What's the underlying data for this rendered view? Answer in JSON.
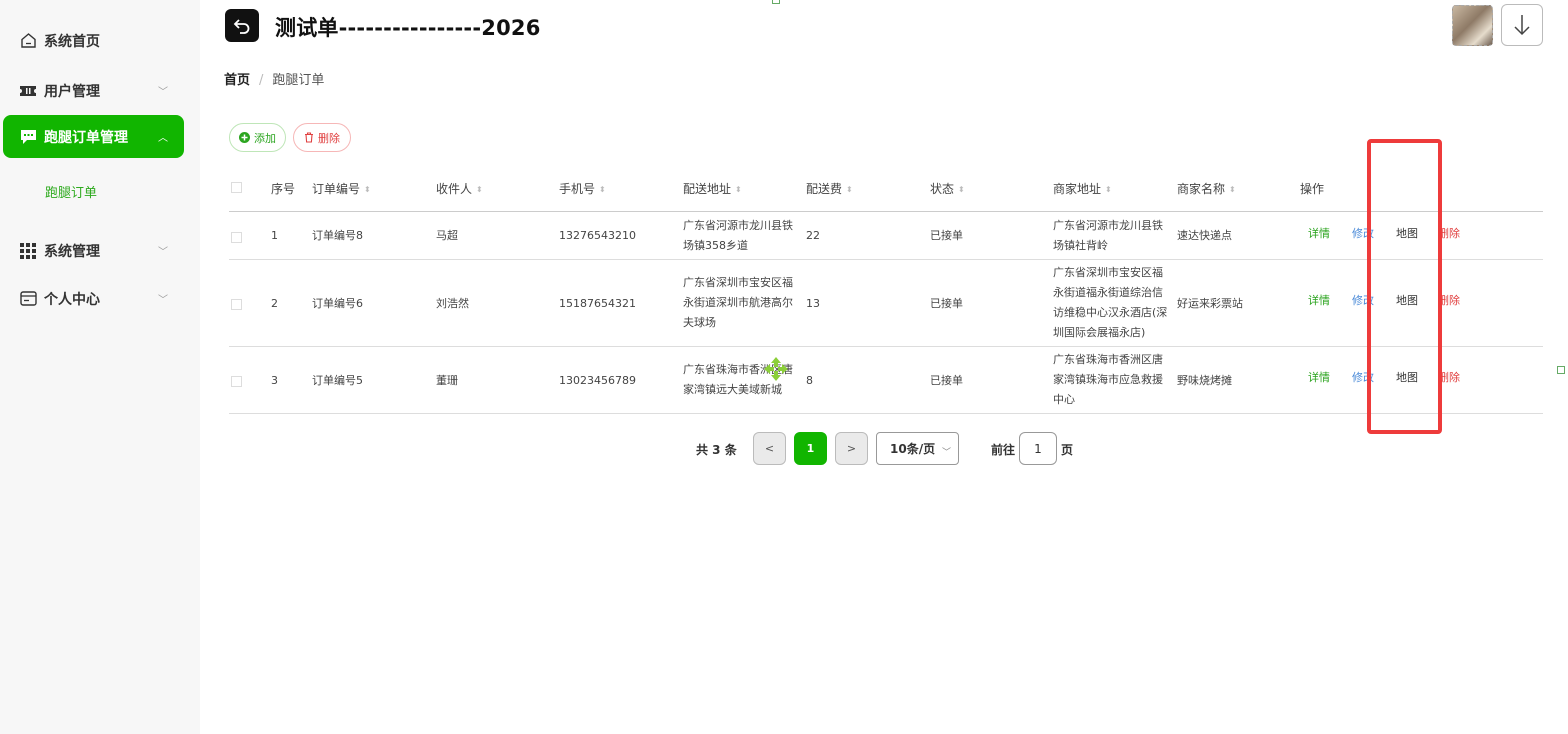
{
  "sidebar": {
    "items": [
      {
        "label": "系统首页"
      },
      {
        "label": "用户管理"
      },
      {
        "label": "跑腿订单管理"
      },
      {
        "label": "系统管理"
      },
      {
        "label": "个人中心"
      }
    ],
    "subitem": "跑腿订单"
  },
  "header": {
    "title": "测试单----------------2026"
  },
  "breadcrumb": {
    "home": "首页",
    "separator": "/",
    "current": "跑腿订单"
  },
  "toolbar": {
    "add_label": "添加",
    "delete_label": "删除"
  },
  "table": {
    "columns": [
      "序号",
      "订单编号",
      "收件人",
      "手机号",
      "配送地址",
      "配送费",
      "状态",
      "商家地址",
      "商家名称",
      "操作"
    ],
    "rows": [
      {
        "index": "1",
        "order_no": "订单编号8",
        "recipient": "马超",
        "phone": "13276543210",
        "address_lines": [
          "广东省河源市龙川县铁",
          "场镇358乡道"
        ],
        "fee": "22",
        "status": "已接单",
        "shop_address_lines": [
          "广东省河源市龙川县铁",
          "场镇社背岭"
        ],
        "shop_name": "速达快递点"
      },
      {
        "index": "2",
        "order_no": "订单编号6",
        "recipient": "刘浩然",
        "phone": "15187654321",
        "address_lines": [
          "广东省深圳市宝安区福",
          "永街道深圳市航港高尔",
          "夫球场"
        ],
        "fee": "13",
        "status": "已接单",
        "shop_address_lines": [
          "广东省深圳市宝安区福",
          "永街道福永街道综治信",
          "访维稳中心汉永酒店(深",
          "圳国际会展福永店)"
        ],
        "shop_name": "好运来彩票站"
      },
      {
        "index": "3",
        "order_no": "订单编号5",
        "recipient": "董珊",
        "phone": "13023456789",
        "address_lines": [
          "广东省珠海市香洲区唐",
          "家湾镇远大美域新城"
        ],
        "fee": "8",
        "status": "已接单",
        "shop_address_lines": [
          "广东省珠海市香洲区唐",
          "家湾镇珠海市应急救援",
          "中心"
        ],
        "shop_name": "野味烧烤摊"
      }
    ],
    "actions": {
      "detail": "详情",
      "edit": "修改",
      "map": "地图",
      "delete": "删除"
    }
  },
  "pagination": {
    "total": "共 3 条",
    "prev": "<",
    "current_page": "1",
    "next": ">",
    "page_size": "10条/页",
    "goto_label": "前往",
    "goto_value": "1",
    "goto_suffix": "页"
  },
  "colors": {
    "accent": "#11b500",
    "danger": "#e03c3c",
    "highlight": "#ee3b3b",
    "link": "#4a8ad8"
  }
}
